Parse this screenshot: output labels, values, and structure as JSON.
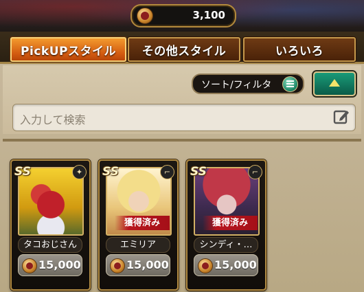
{
  "header": {
    "currency_value": "3,100",
    "currency_icon": "coin-icon"
  },
  "tabs": [
    {
      "label": "PickUPスタイル",
      "active": true
    },
    {
      "label": "その他スタイル",
      "active": false
    },
    {
      "label": "いろいろ",
      "active": false
    }
  ],
  "filter": {
    "sort_label": "ソート/フィルタ",
    "sort_icon": "menu-icon",
    "toggle_icon": "chevron-up-icon"
  },
  "search": {
    "placeholder": "入力して検索",
    "icon": "edit-icon"
  },
  "cards": [
    {
      "name": "タコおじさん",
      "rank": "SS",
      "weapon": "staff-icon",
      "owned": false,
      "owned_label": "",
      "price": "15,000"
    },
    {
      "name": "エミリア",
      "rank": "SS",
      "weapon": "gun-icon",
      "owned": true,
      "owned_label": "獲得済み",
      "price": "15,000"
    },
    {
      "name": "シンディ・…",
      "rank": "SS",
      "weapon": "gun-icon",
      "owned": true,
      "owned_label": "獲得済み",
      "price": "15,000"
    }
  ],
  "colors": {
    "accent_orange": "#e07018",
    "gold_border": "#b08a42",
    "teal_button": "#1a9a78"
  }
}
